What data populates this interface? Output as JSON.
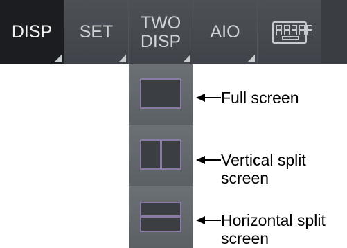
{
  "toolbar": {
    "buttons": [
      {
        "label": "DISP",
        "state": "selected"
      },
      {
        "label": "SET"
      },
      {
        "line1": "TWO",
        "line2": "DISP"
      },
      {
        "label": "AIO"
      },
      {
        "icon": "keyboard-icon"
      }
    ]
  },
  "dropdown": {
    "items": [
      {
        "icon": "full-screen-icon"
      },
      {
        "icon": "vertical-split-icon"
      },
      {
        "icon": "horizontal-split-icon"
      }
    ]
  },
  "callouts": {
    "full": "Full screen",
    "vertical": "Vertical split\nscreen",
    "horizontal": "Horizontal split\nscreen"
  },
  "colors": {
    "toolbar_bg": "#3a3e42",
    "active_button": "#1b1d20",
    "icon_outline": "#8c7aa6"
  }
}
